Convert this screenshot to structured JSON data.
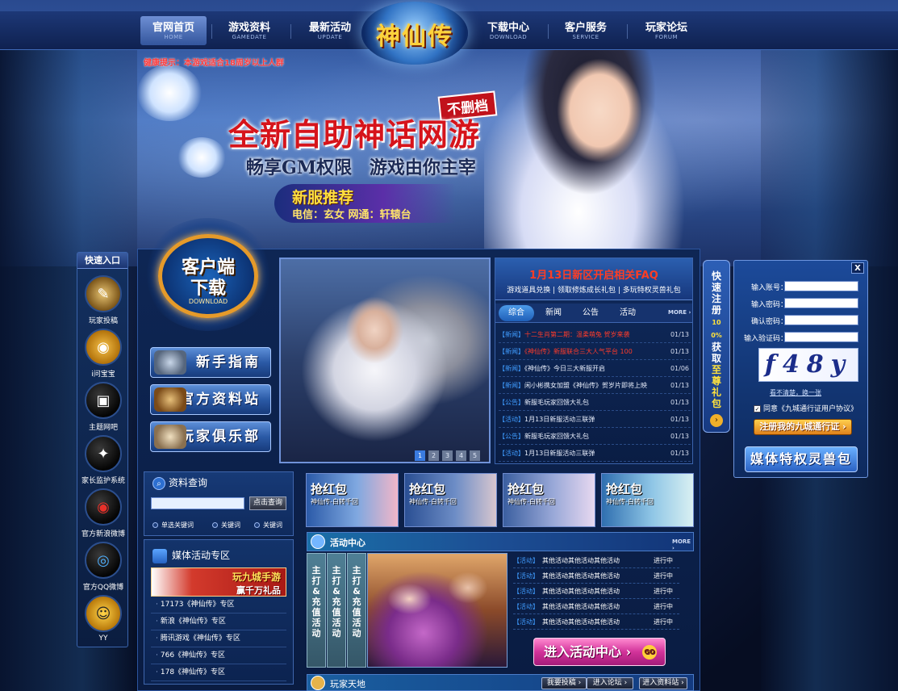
{
  "nav": {
    "items": [
      {
        "cn": "官网首页",
        "en": "HOME"
      },
      {
        "cn": "游戏资料",
        "en": "GAMEDATE"
      },
      {
        "cn": "最新活动",
        "en": "UPDATE"
      },
      {
        "cn": "下载中心",
        "en": "DOWNLOAD"
      },
      {
        "cn": "客户服务",
        "en": "SERVICE"
      },
      {
        "cn": "玩家论坛",
        "en": "FORUM"
      }
    ],
    "logo": "神仙传"
  },
  "hero": {
    "warning": "健康提示：本游戏适合18周岁以上人群",
    "tag": "不删档",
    "slogan": "全新自助神话网游",
    "sub1": "畅享GM权限",
    "sub2": "游戏由你主宰",
    "newserver_title": "新服推荐",
    "newserver_line": "电信：玄女   网通：轩辕台"
  },
  "quick": {
    "title": "快速入口",
    "items": [
      {
        "label": "玩家投稿",
        "icon": "scroll-icon"
      },
      {
        "label": "i问宝宝",
        "icon": "weibo-baby-icon"
      },
      {
        "label": "主题网吧",
        "icon": "netbar-icon"
      },
      {
        "label": "家长监护系统",
        "icon": "parent-monitor-icon"
      },
      {
        "label": "官方新浪微博",
        "icon": "sina-weibo-icon"
      },
      {
        "label": "官方QQ微博",
        "icon": "qq-weibo-icon"
      },
      {
        "label": "YY",
        "icon": "yy-icon"
      }
    ]
  },
  "client": {
    "line1": "客户端",
    "line2": "下载",
    "en": "DOWNLOAD"
  },
  "left_buttons": [
    "新手指南",
    "官方资料站",
    "玩家俱乐部"
  ],
  "slideshow": {
    "pages": [
      "1",
      "2",
      "3",
      "4",
      "5"
    ],
    "active": 1
  },
  "news": {
    "headline": "1月13日新区开启相关FAQ",
    "subline": "游戏道具兑换 | 领取修炼成长礼包 | 多玩特权灵兽礼包",
    "tabs": [
      "综合",
      "新闻",
      "公告",
      "活动"
    ],
    "more": "MORE ›",
    "rows": [
      {
        "tag": "【新闻】",
        "text": "十二生肖第二期：温柔萌兔 贺岁来袭",
        "date": "01/13",
        "red": true
      },
      {
        "tag": "【新闻】",
        "text": "《神仙传》新服联合三大人气平台 100",
        "date": "01/13",
        "red": true
      },
      {
        "tag": "【新闻】",
        "text": "《神仙传》今日三大新服开启",
        "date": "01/06",
        "red": false
      },
      {
        "tag": "【新闻】",
        "text": "闲小彬携女加盟《神仙传》贺岁片即将上映",
        "date": "01/13",
        "red": false
      },
      {
        "tag": "【公告】",
        "text": "新服毛玩家回馈大礼包",
        "date": "01/13",
        "red": false
      },
      {
        "tag": "【活动】",
        "text": "1月13日新服活动三联弹",
        "date": "01/13",
        "red": false
      },
      {
        "tag": "【公告】",
        "text": "新服毛玩家回馈大礼包",
        "date": "01/13",
        "red": false
      },
      {
        "tag": "【活动】",
        "text": "1月13日新服活动三联弹",
        "date": "01/13",
        "red": false
      }
    ]
  },
  "register_vertical": {
    "text1": "快速注册",
    "text2": "100%",
    "text3": "获取",
    "text4": "至尊礼包"
  },
  "login": {
    "close": "X",
    "account_label": "输入账号：",
    "password_label": "输入密码：",
    "confirm_label": "确认密码：",
    "captcha_label": "输入验证码：",
    "captcha": "f48y",
    "refresh": "看不清楚，换一张",
    "agree": "同意《九城通行证用户协议》",
    "register_button": "注册我的九城通行证 ›",
    "beast_button": "媒体特权灵兽包"
  },
  "search": {
    "title": "资料查询",
    "button": "点击查询",
    "options": [
      "单选关键词",
      "关键词",
      "关键词"
    ]
  },
  "media": {
    "title": "媒体活动专区",
    "banner1": "玩九城手游",
    "banner2": "赢千万礼品",
    "rows": [
      "17173《神仙传》专区",
      "新浪《神仙传》专区",
      "腾讯游戏《神仙传》专区",
      "766《神仙传》专区",
      "178《神仙传》专区"
    ]
  },
  "cards": [
    {
      "title": "抢红包",
      "sub": "神仙传-白转千回"
    },
    {
      "title": "抢红包",
      "sub": "神仙传-白转千回"
    },
    {
      "title": "抢红包",
      "sub": "神仙传-白转千回"
    },
    {
      "title": "抢红包",
      "sub": "神仙传-白转千回"
    }
  ],
  "activity": {
    "title": "活动中心",
    "more": "MORE ›",
    "vtabs": [
      "主打&充值活动",
      "主打&充值活动",
      "主打&充值活动"
    ],
    "rows": [
      {
        "tag": "【活动】",
        "text": "其他活动其他活动其他活动",
        "status": "进行中"
      },
      {
        "tag": "【活动】",
        "text": "其他活动其他活动其他活动",
        "status": "进行中"
      },
      {
        "tag": "【活动】",
        "text": "其他活动其他活动其他活动",
        "status": "进行中"
      },
      {
        "tag": "【活动】",
        "text": "其他活动其他活动其他活动",
        "status": "进行中"
      },
      {
        "tag": "【活动】",
        "text": "其他活动其他活动其他活动",
        "status": "进行中"
      }
    ],
    "enter": "进入活动中心 ›",
    "go": "GO"
  },
  "player": {
    "title": "玩家天地",
    "buttons": [
      "我要投稿 ›",
      "进入论坛 ›",
      "进入资料站 ›"
    ]
  }
}
